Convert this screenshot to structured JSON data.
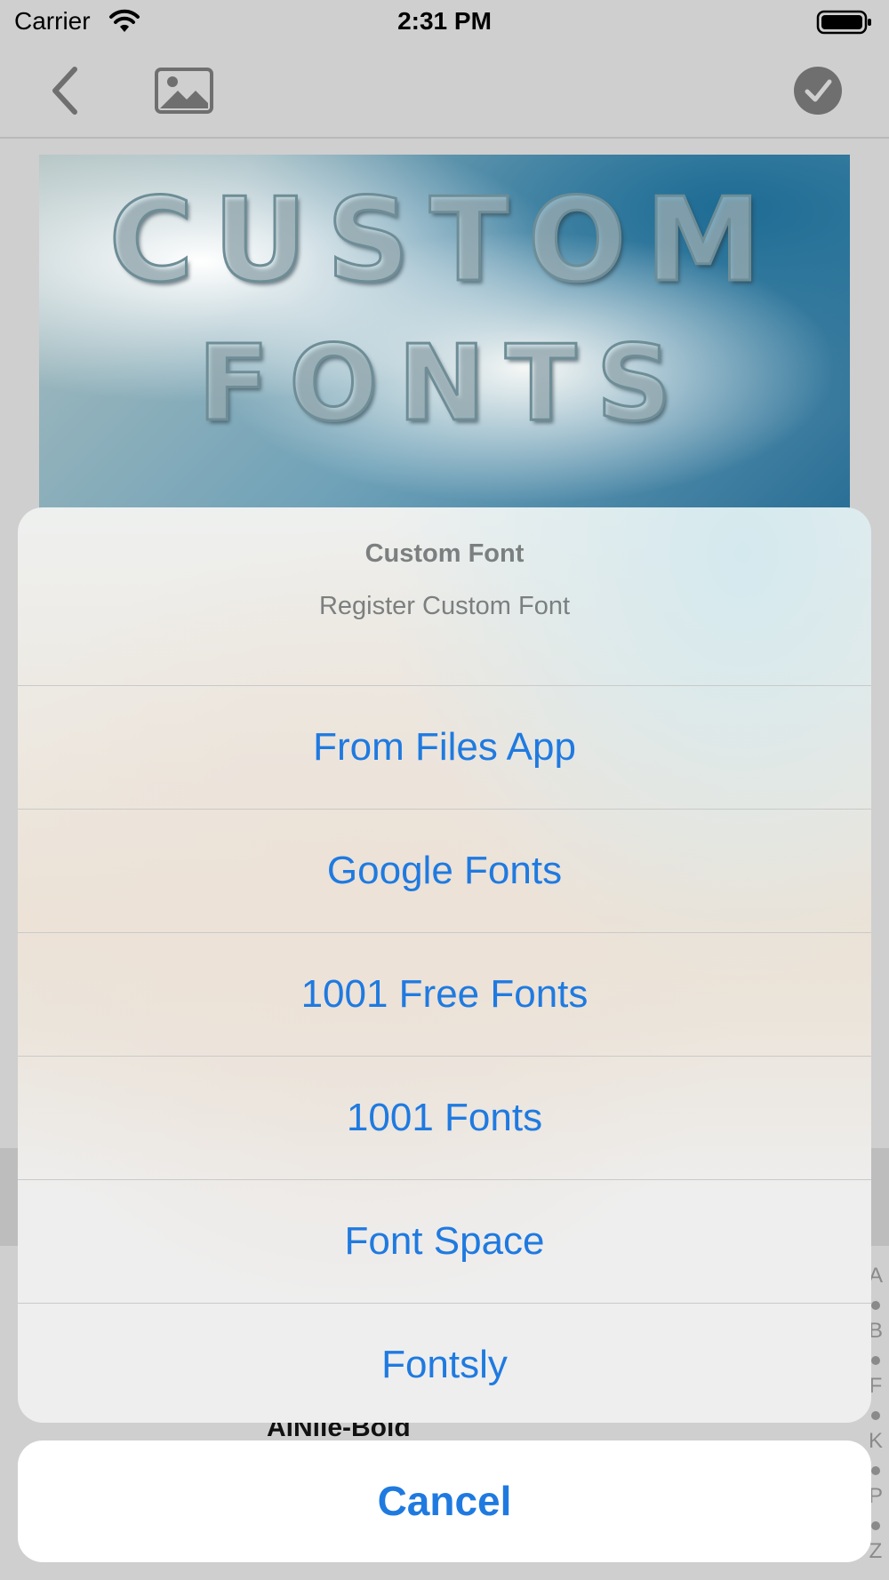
{
  "status_bar": {
    "carrier": "Carrier",
    "time": "2:31 PM"
  },
  "preview": {
    "line1": "CUSTOM",
    "line2": "FONTS"
  },
  "action_sheet": {
    "title": "Custom Font",
    "message": "Register Custom Font",
    "items": [
      {
        "label": "From Files App"
      },
      {
        "label": "Google Fonts"
      },
      {
        "label": "1001 Free Fonts"
      },
      {
        "label": "1001 Fonts"
      },
      {
        "label": "Font Space"
      },
      {
        "label": "Fontsly"
      }
    ],
    "cancel_label": "Cancel"
  },
  "font_list": {
    "visible_item": "AlNile-Bold"
  },
  "index_bar": {
    "letters": [
      "A",
      "B",
      "F",
      "K",
      "P",
      "Z"
    ]
  },
  "colors": {
    "accent": "#1f7ae0",
    "dim_background": "#cfcfcf"
  },
  "icons": {
    "back": "chevron-left-icon",
    "image": "photo-icon",
    "done": "checkmark-circle-icon",
    "wifi": "wifi-icon",
    "battery": "battery-icon"
  }
}
